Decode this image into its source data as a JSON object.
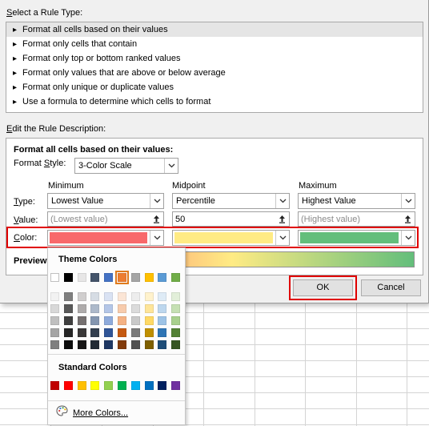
{
  "select_rule_type": {
    "label": "Select a Rule Type:",
    "items": [
      "Format all cells based on their values",
      "Format only cells that contain",
      "Format only top or bottom ranked values",
      "Format only values that are above or below average",
      "Format only unique or duplicate values",
      "Use a formula to determine which cells to format"
    ],
    "selected_index": 0
  },
  "edit_rule": {
    "label": "Edit the Rule Description:",
    "heading": "Format all cells based on their values:",
    "format_style_label": "Format Style:",
    "format_style_value": "3-Color Scale",
    "columns": [
      "Minimum",
      "Midpoint",
      "Maximum"
    ],
    "row_labels": {
      "type": "Type:",
      "value": "Value:",
      "color": "Color:",
      "preview": "Preview:"
    },
    "type_values": [
      "Lowest Value",
      "Percentile",
      "Highest Value"
    ],
    "value_values": [
      "(Lowest value)",
      "50",
      "(Highest value)"
    ],
    "colors": [
      "#f8696b",
      "#ffeb84",
      "#63be7b"
    ]
  },
  "buttons": {
    "ok": "OK",
    "cancel": "Cancel"
  },
  "palette": {
    "theme_title": "Theme Colors",
    "standard_title": "Standard Colors",
    "more_label": "More Colors...",
    "theme_top": [
      "#ffffff",
      "#000000",
      "#e7e6e6",
      "#44546a",
      "#4472c4",
      "#ed7d31",
      "#a5a5a5",
      "#ffc000",
      "#5b9bd5",
      "#70ad47"
    ],
    "theme_shades": [
      [
        "#f2f2f2",
        "#7f7f7f",
        "#d0cece",
        "#d6dce4",
        "#d9e2f3",
        "#fbe5d5",
        "#ededed",
        "#fff2cc",
        "#deebf6",
        "#e2efd9"
      ],
      [
        "#d8d8d8",
        "#595959",
        "#aeabab",
        "#adb9ca",
        "#b4c6e7",
        "#f7cbac",
        "#dbdbdb",
        "#fee599",
        "#bdd7ee",
        "#c5e0b3"
      ],
      [
        "#bfbfbf",
        "#3f3f3f",
        "#757070",
        "#8496b0",
        "#8eaadb",
        "#f4b183",
        "#c9c9c9",
        "#ffd965",
        "#9dc3e6",
        "#a8d08d"
      ],
      [
        "#a5a5a5",
        "#262626",
        "#3a3838",
        "#333f4f",
        "#2f5496",
        "#c55a11",
        "#7b7b7b",
        "#bf8f00",
        "#2e75b5",
        "#538135"
      ],
      [
        "#7f7f7f",
        "#0c0c0c",
        "#171616",
        "#222a35",
        "#1f3864",
        "#833c0b",
        "#525252",
        "#7f6000",
        "#1e4e79",
        "#375623"
      ]
    ],
    "standard": [
      "#c00000",
      "#ff0000",
      "#ffc000",
      "#ffff00",
      "#92d050",
      "#00b050",
      "#00b0f0",
      "#0070c0",
      "#002060",
      "#7030a0"
    ]
  }
}
